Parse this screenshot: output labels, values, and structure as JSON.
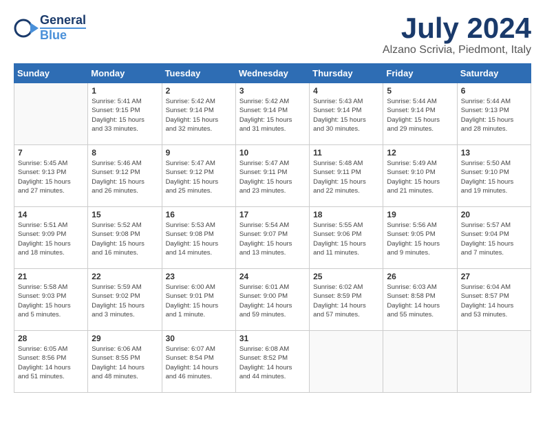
{
  "header": {
    "logo_general": "General",
    "logo_blue": "Blue",
    "month": "July 2024",
    "location": "Alzano Scrivia, Piedmont, Italy"
  },
  "weekdays": [
    "Sunday",
    "Monday",
    "Tuesday",
    "Wednesday",
    "Thursday",
    "Friday",
    "Saturday"
  ],
  "weeks": [
    [
      {
        "day": "",
        "info": ""
      },
      {
        "day": "1",
        "info": "Sunrise: 5:41 AM\nSunset: 9:15 PM\nDaylight: 15 hours\nand 33 minutes."
      },
      {
        "day": "2",
        "info": "Sunrise: 5:42 AM\nSunset: 9:14 PM\nDaylight: 15 hours\nand 32 minutes."
      },
      {
        "day": "3",
        "info": "Sunrise: 5:42 AM\nSunset: 9:14 PM\nDaylight: 15 hours\nand 31 minutes."
      },
      {
        "day": "4",
        "info": "Sunrise: 5:43 AM\nSunset: 9:14 PM\nDaylight: 15 hours\nand 30 minutes."
      },
      {
        "day": "5",
        "info": "Sunrise: 5:44 AM\nSunset: 9:14 PM\nDaylight: 15 hours\nand 29 minutes."
      },
      {
        "day": "6",
        "info": "Sunrise: 5:44 AM\nSunset: 9:13 PM\nDaylight: 15 hours\nand 28 minutes."
      }
    ],
    [
      {
        "day": "7",
        "info": "Sunrise: 5:45 AM\nSunset: 9:13 PM\nDaylight: 15 hours\nand 27 minutes."
      },
      {
        "day": "8",
        "info": "Sunrise: 5:46 AM\nSunset: 9:12 PM\nDaylight: 15 hours\nand 26 minutes."
      },
      {
        "day": "9",
        "info": "Sunrise: 5:47 AM\nSunset: 9:12 PM\nDaylight: 15 hours\nand 25 minutes."
      },
      {
        "day": "10",
        "info": "Sunrise: 5:47 AM\nSunset: 9:11 PM\nDaylight: 15 hours\nand 23 minutes."
      },
      {
        "day": "11",
        "info": "Sunrise: 5:48 AM\nSunset: 9:11 PM\nDaylight: 15 hours\nand 22 minutes."
      },
      {
        "day": "12",
        "info": "Sunrise: 5:49 AM\nSunset: 9:10 PM\nDaylight: 15 hours\nand 21 minutes."
      },
      {
        "day": "13",
        "info": "Sunrise: 5:50 AM\nSunset: 9:10 PM\nDaylight: 15 hours\nand 19 minutes."
      }
    ],
    [
      {
        "day": "14",
        "info": "Sunrise: 5:51 AM\nSunset: 9:09 PM\nDaylight: 15 hours\nand 18 minutes."
      },
      {
        "day": "15",
        "info": "Sunrise: 5:52 AM\nSunset: 9:08 PM\nDaylight: 15 hours\nand 16 minutes."
      },
      {
        "day": "16",
        "info": "Sunrise: 5:53 AM\nSunset: 9:08 PM\nDaylight: 15 hours\nand 14 minutes."
      },
      {
        "day": "17",
        "info": "Sunrise: 5:54 AM\nSunset: 9:07 PM\nDaylight: 15 hours\nand 13 minutes."
      },
      {
        "day": "18",
        "info": "Sunrise: 5:55 AM\nSunset: 9:06 PM\nDaylight: 15 hours\nand 11 minutes."
      },
      {
        "day": "19",
        "info": "Sunrise: 5:56 AM\nSunset: 9:05 PM\nDaylight: 15 hours\nand 9 minutes."
      },
      {
        "day": "20",
        "info": "Sunrise: 5:57 AM\nSunset: 9:04 PM\nDaylight: 15 hours\nand 7 minutes."
      }
    ],
    [
      {
        "day": "21",
        "info": "Sunrise: 5:58 AM\nSunset: 9:03 PM\nDaylight: 15 hours\nand 5 minutes."
      },
      {
        "day": "22",
        "info": "Sunrise: 5:59 AM\nSunset: 9:02 PM\nDaylight: 15 hours\nand 3 minutes."
      },
      {
        "day": "23",
        "info": "Sunrise: 6:00 AM\nSunset: 9:01 PM\nDaylight: 15 hours\nand 1 minute."
      },
      {
        "day": "24",
        "info": "Sunrise: 6:01 AM\nSunset: 9:00 PM\nDaylight: 14 hours\nand 59 minutes."
      },
      {
        "day": "25",
        "info": "Sunrise: 6:02 AM\nSunset: 8:59 PM\nDaylight: 14 hours\nand 57 minutes."
      },
      {
        "day": "26",
        "info": "Sunrise: 6:03 AM\nSunset: 8:58 PM\nDaylight: 14 hours\nand 55 minutes."
      },
      {
        "day": "27",
        "info": "Sunrise: 6:04 AM\nSunset: 8:57 PM\nDaylight: 14 hours\nand 53 minutes."
      }
    ],
    [
      {
        "day": "28",
        "info": "Sunrise: 6:05 AM\nSunset: 8:56 PM\nDaylight: 14 hours\nand 51 minutes."
      },
      {
        "day": "29",
        "info": "Sunrise: 6:06 AM\nSunset: 8:55 PM\nDaylight: 14 hours\nand 48 minutes."
      },
      {
        "day": "30",
        "info": "Sunrise: 6:07 AM\nSunset: 8:54 PM\nDaylight: 14 hours\nand 46 minutes."
      },
      {
        "day": "31",
        "info": "Sunrise: 6:08 AM\nSunset: 8:52 PM\nDaylight: 14 hours\nand 44 minutes."
      },
      {
        "day": "",
        "info": ""
      },
      {
        "day": "",
        "info": ""
      },
      {
        "day": "",
        "info": ""
      }
    ]
  ]
}
